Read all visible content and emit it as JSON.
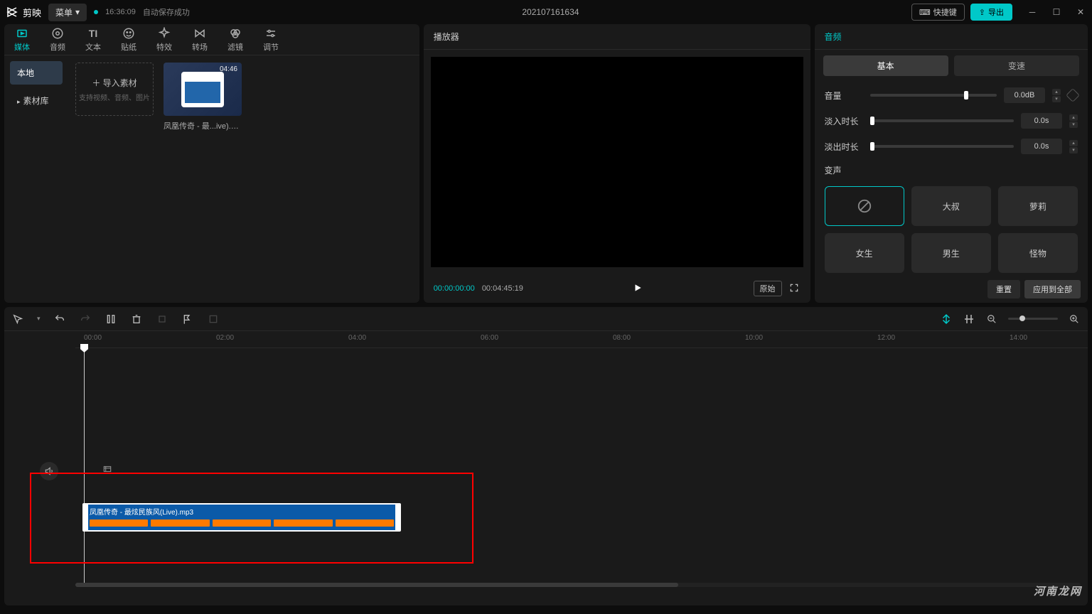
{
  "titleBar": {
    "appName": "剪映",
    "menuLabel": "菜单",
    "autosaveTime": "16:36:09",
    "autosaveText": "自动保存成功",
    "projectName": "202107161634",
    "shortcutLabel": "快捷键",
    "exportLabel": "导出"
  },
  "tabs": [
    {
      "label": "媒体"
    },
    {
      "label": "音频"
    },
    {
      "label": "文本"
    },
    {
      "label": "贴纸"
    },
    {
      "label": "特效"
    },
    {
      "label": "转场"
    },
    {
      "label": "滤镜"
    },
    {
      "label": "调节"
    }
  ],
  "categories": {
    "local": "本地",
    "library": "素材库"
  },
  "importCard": {
    "title": "导入素材",
    "hint": "支持视频、音频、图片"
  },
  "mediaItem": {
    "duration": "04:46",
    "name": "凤凰传奇 - 最...ive).mp3"
  },
  "preview": {
    "title": "播放器",
    "current": "00:00:00:00",
    "total": "00:04:45:19",
    "ratio": "原始"
  },
  "rightPanel": {
    "title": "音频",
    "tabBasic": "基本",
    "tabSpeed": "变速",
    "volumeLabel": "音量",
    "volumeValue": "0.0dB",
    "fadeInLabel": "淡入时长",
    "fadeInValue": "0.0s",
    "fadeOutLabel": "淡出时长",
    "fadeOutValue": "0.0s",
    "voiceChangeLabel": "变声",
    "voices": {
      "v1": "大叔",
      "v2": "萝莉",
      "v3": "女生",
      "v4": "男生",
      "v5": "怪物"
    },
    "resetLabel": "重置",
    "applyAllLabel": "应用到全部"
  },
  "timeline": {
    "marks": [
      "00:00",
      "02:00",
      "04:00",
      "06:00",
      "08:00",
      "10:00",
      "12:00",
      "14:00"
    ],
    "clipName": "凤凰传奇 - 最炫民族风(Live).mp3"
  },
  "watermark": "河南龙网"
}
